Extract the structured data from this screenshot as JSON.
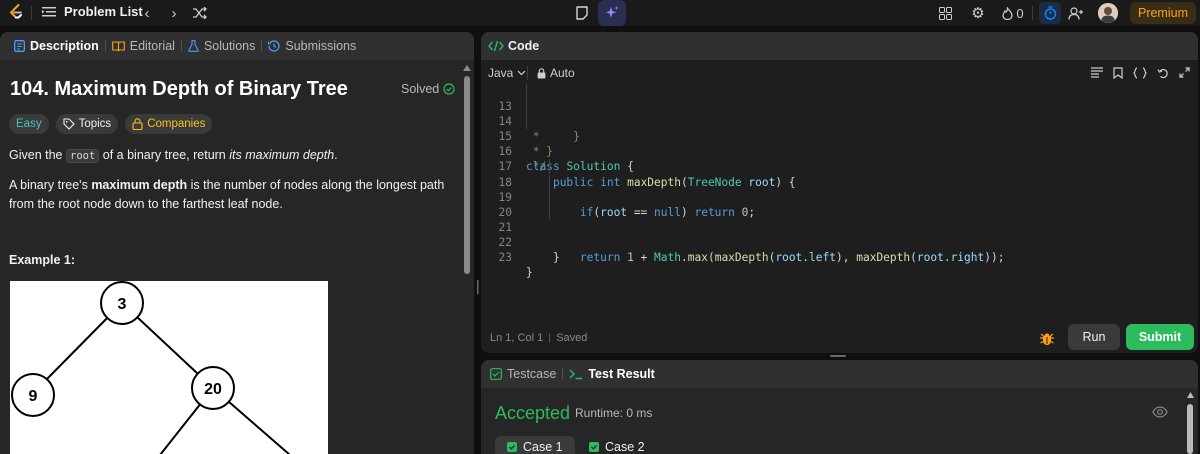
{
  "topbar": {
    "problem_list_label": "Problem List",
    "fire_count": "0",
    "premium_label": "Premium"
  },
  "left_tabs": [
    {
      "label": "Description",
      "icon": "document-icon",
      "active": true
    },
    {
      "label": "Editorial",
      "icon": "book-icon",
      "active": false
    },
    {
      "label": "Solutions",
      "icon": "flask-icon",
      "active": false
    },
    {
      "label": "Submissions",
      "icon": "history-icon",
      "active": false
    }
  ],
  "problem": {
    "title": "104. Maximum Depth of Binary Tree",
    "status": "Solved",
    "difficulty": "Easy",
    "topics_label": "Topics",
    "companies_label": "Companies",
    "intro_before": "Given the",
    "intro_code": "root",
    "intro_mid": "of a binary tree, return",
    "intro_em": "its maximum depth",
    "intro_after": ".",
    "def_before": "A binary tree's",
    "def_strong": "maximum depth",
    "def_after": "is the number of nodes along the longest path from the root node down to the farthest leaf node.",
    "example_label": "Example 1:",
    "tree_nodes": [
      "3",
      "9",
      "20"
    ]
  },
  "code_panel": {
    "header_label": "Code",
    "language": "Java",
    "auto_label": "Auto",
    "lines": [
      {
        "n": "13",
        "text": " *     }"
      },
      {
        "n": "14",
        "text": " * }"
      },
      {
        "n": "15",
        "text": " */"
      },
      {
        "n": "16",
        "text": "class Solution {"
      },
      {
        "n": "17",
        "text": "    public int maxDepth(TreeNode root) {"
      },
      {
        "n": "18",
        "text": "        if(root == null) return 0;"
      },
      {
        "n": "19",
        "text": ""
      },
      {
        "n": "20",
        "text": ""
      },
      {
        "n": "21",
        "text": "        return 1 + Math.max(maxDepth(root.left), maxDepth(root.right));"
      },
      {
        "n": "22",
        "text": "    }"
      },
      {
        "n": "23",
        "text": "}"
      }
    ],
    "cursor_position": "Ln 1, Col 1",
    "saved_label": "Saved",
    "run_label": "Run",
    "submit_label": "Submit"
  },
  "result_panel": {
    "testcase_label": "Testcase",
    "test_result_label": "Test Result",
    "verdict": "Accepted",
    "runtime": "Runtime: 0 ms",
    "cases": [
      {
        "label": "Case 1",
        "active": true
      },
      {
        "label": "Case 2",
        "active": false
      }
    ]
  },
  "colors": {
    "accent_orange": "#ffa116",
    "accepted_green": "#2cbb5d",
    "easy_teal": "#46c6c2",
    "companies_yellow": "#ffc01e",
    "timer_blue": "#0a84ff"
  }
}
